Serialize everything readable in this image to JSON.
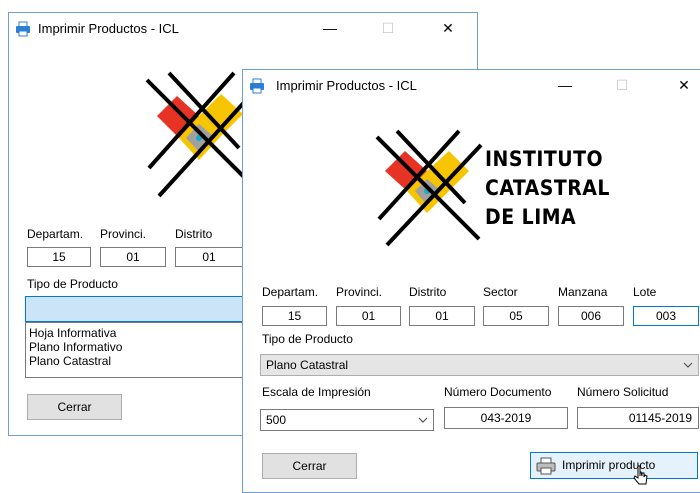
{
  "back_window": {
    "title": "Imprimir Productos - ICL",
    "controls": {
      "minimize": "—",
      "maximize": "☐",
      "close": "✕"
    },
    "fields": {
      "departamento": {
        "label": "Departam.",
        "value": "15"
      },
      "provincia": {
        "label": "Provinci.",
        "value": "01"
      },
      "distrito": {
        "label": "Distrito",
        "value": "01"
      }
    },
    "tipo_producto": {
      "label": "Tipo de Producto",
      "value": "",
      "options": [
        "Hoja Informativa",
        "Plano Informativo",
        "Plano Catastral"
      ]
    },
    "close_button": "Cerrar"
  },
  "front_window": {
    "title": "Imprimir Productos - ICL",
    "controls": {
      "minimize": "—",
      "maximize": "☐",
      "close": "✕"
    },
    "logo": {
      "line1": "INSTITUTO",
      "line2": "CATASTRAL",
      "line3": "DE LIMA"
    },
    "fields": {
      "departamento": {
        "label": "Departam.",
        "value": "15"
      },
      "provincia": {
        "label": "Provinci.",
        "value": "01"
      },
      "distrito": {
        "label": "Distrito",
        "value": "01"
      },
      "sector": {
        "label": "Sector",
        "value": "05"
      },
      "manzana": {
        "label": "Manzana",
        "value": "006"
      },
      "lote": {
        "label": "Lote",
        "value": "003"
      }
    },
    "tipo_producto": {
      "label": "Tipo de Producto",
      "value": "Plano Catastral"
    },
    "escala": {
      "label": "Escala de Impresión",
      "value": "500"
    },
    "numero_documento": {
      "label": "Número Documento",
      "value": "043-2019"
    },
    "numero_solicitud": {
      "label": "Número Solicitud",
      "value": "01145-2019"
    },
    "close_button": "Cerrar",
    "print_button": "Imprimir producto"
  },
  "colors": {
    "window_border": "#6b9fd6",
    "accent": "#0078d7",
    "logo_red": "#e63324",
    "logo_yellow": "#f6c500"
  }
}
